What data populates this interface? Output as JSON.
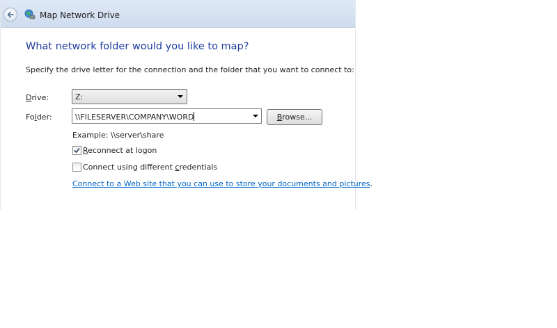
{
  "window": {
    "title": "Map Network Drive"
  },
  "page": {
    "heading": "What network folder would you like to map?",
    "instruction": "Specify the drive letter for the connection and the folder that you want to connect to:"
  },
  "drive": {
    "label_prefix": "D",
    "label_rest": "rive:",
    "selected": "Z:"
  },
  "folder": {
    "label_prefix": "Fo",
    "label_access": "l",
    "label_rest": "der:",
    "value": "\\\\FILESERVER\\COMPANY\\WORD"
  },
  "browse": {
    "access_key": "B",
    "label_rest": "rowse..."
  },
  "example": "Example: \\\\server\\share",
  "reconnect": {
    "access_key": "R",
    "label_rest": "econnect at logon",
    "checked": true
  },
  "credentials": {
    "label_prefix": "Connect using different ",
    "access_key": "c",
    "label_rest": "redentials",
    "checked": false
  },
  "link": {
    "text": "Connect to a Web site that you can use to store your documents and pictures",
    "suffix": "."
  },
  "icons": {
    "back": "back-arrow-icon",
    "app": "network-drive-icon",
    "checkmark": "checkmark-icon",
    "dropdown": "chevron-down-icon"
  },
  "colors": {
    "heading": "#1f3d9e",
    "link": "#0066cc",
    "titlebar": "#dfe9f6"
  }
}
